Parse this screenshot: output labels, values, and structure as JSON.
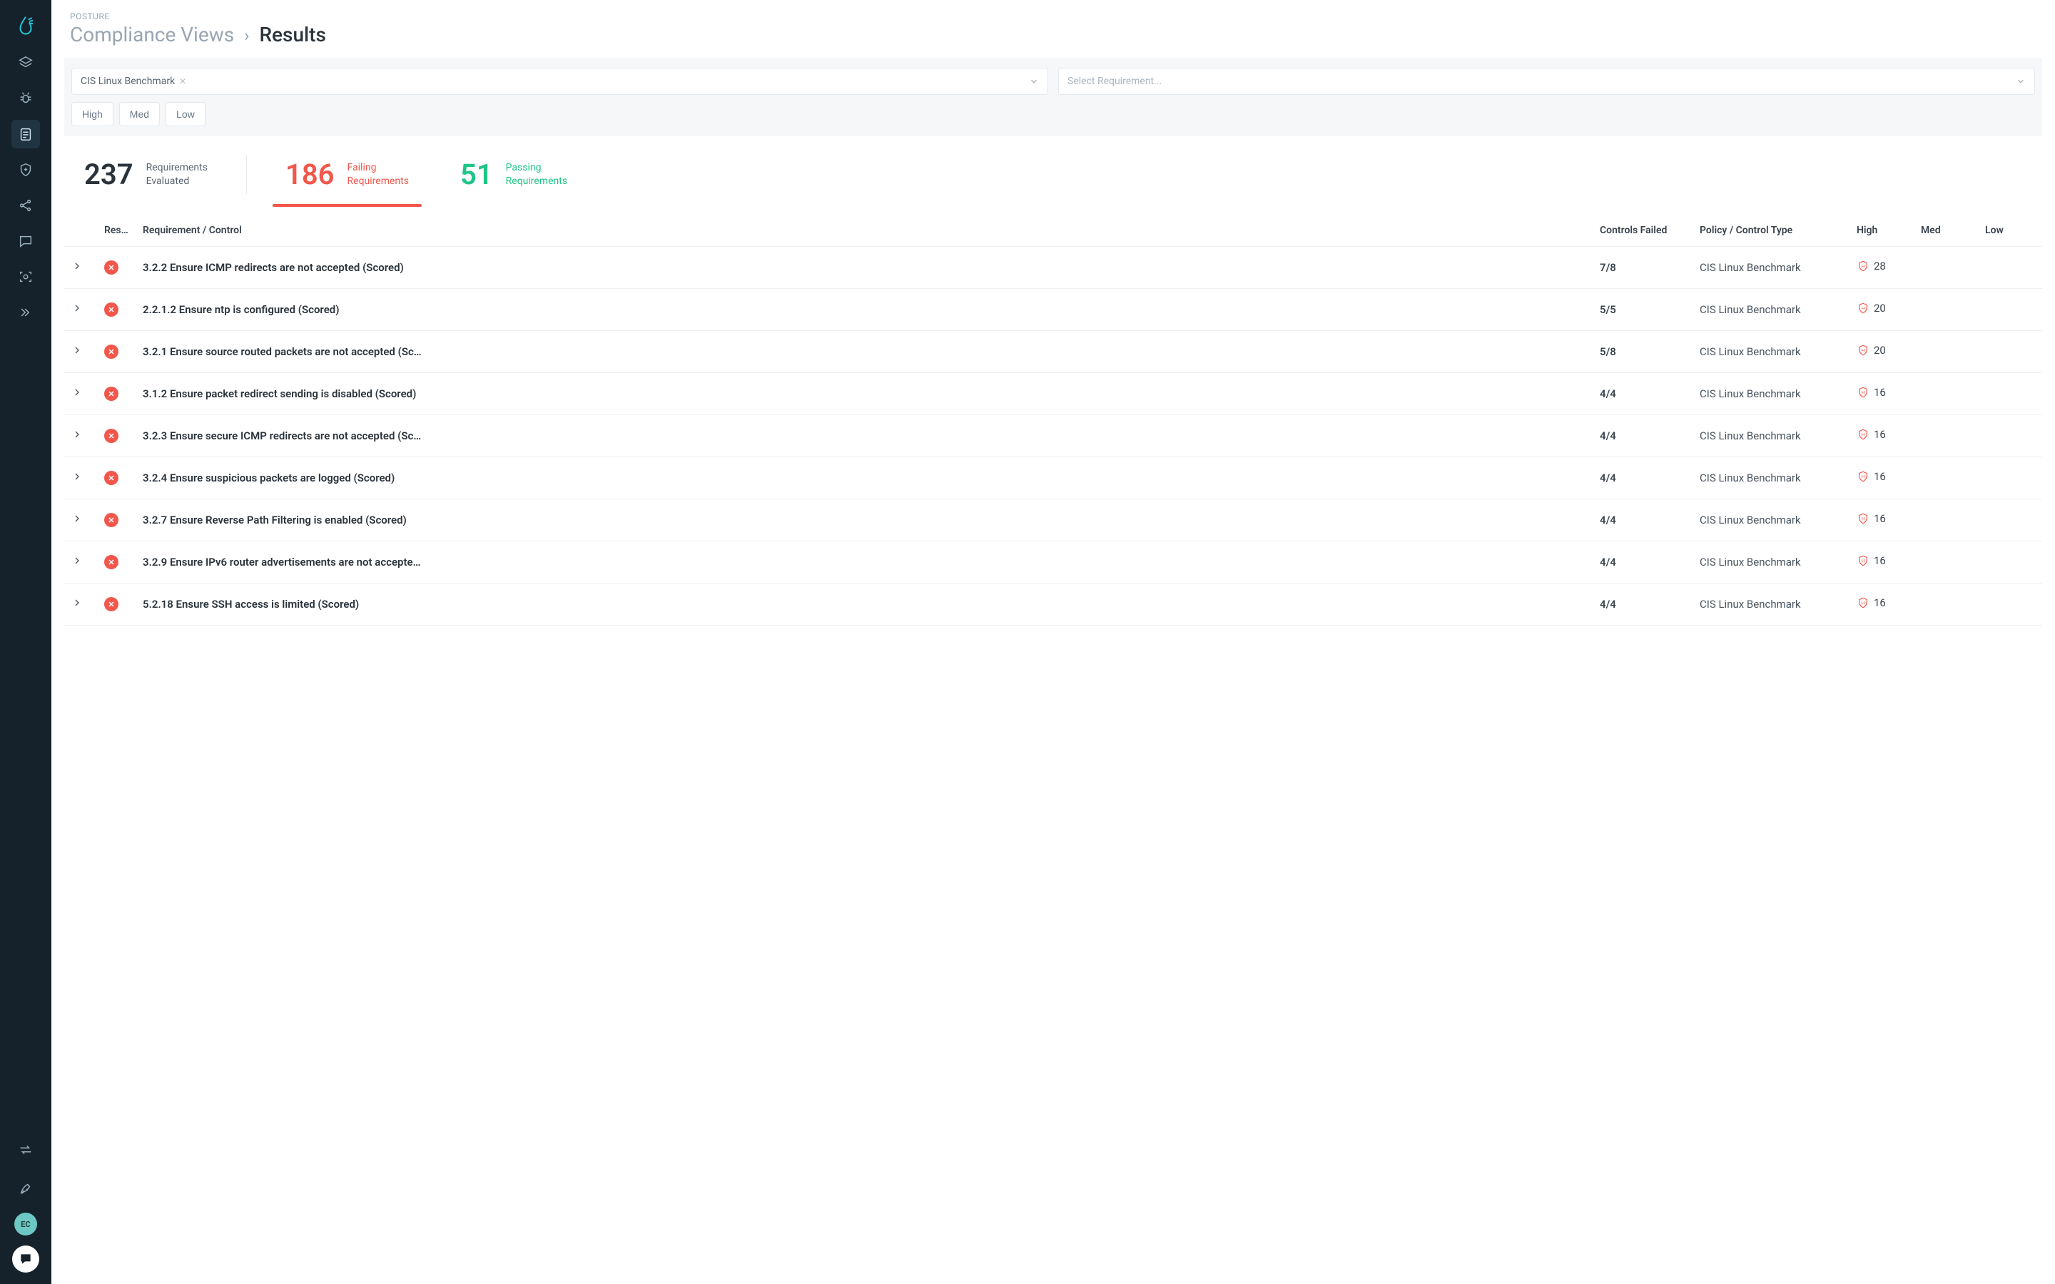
{
  "header": {
    "eyebrow": "POSTURE",
    "breadcrumb_parent": "Compliance Views",
    "breadcrumb_sep": "›",
    "breadcrumb_current": "Results"
  },
  "filters": {
    "benchmark_chip": "CIS Linux Benchmark",
    "requirement_placeholder": "Select Requirement...",
    "severity_labels": {
      "high": "High",
      "med": "Med",
      "low": "Low"
    }
  },
  "stats": {
    "total": {
      "value": "237",
      "label_l1": "Requirements",
      "label_l2": "Evaluated"
    },
    "fail": {
      "value": "186",
      "label_l1": "Failing",
      "label_l2": "Requirements"
    },
    "pass": {
      "value": "51",
      "label_l1": "Passing",
      "label_l2": "Requirements"
    }
  },
  "table": {
    "headers": {
      "result": "Res…",
      "requirement": "Requirement / Control",
      "controls_failed": "Controls Failed",
      "policy": "Policy / Control Type",
      "high": "High",
      "med": "Med",
      "low": "Low"
    },
    "rows": [
      {
        "req": "3.2.2 Ensure ICMP redirects are not accepted (Scored)",
        "cf": "7/8",
        "policy": "CIS Linux Benchmark",
        "high": "28"
      },
      {
        "req": "2.2.1.2 Ensure ntp is configured (Scored)",
        "cf": "5/5",
        "policy": "CIS Linux Benchmark",
        "high": "20"
      },
      {
        "req": "3.2.1 Ensure source routed packets are not accepted (Sc…",
        "cf": "5/8",
        "policy": "CIS Linux Benchmark",
        "high": "20"
      },
      {
        "req": "3.1.2 Ensure packet redirect sending is disabled (Scored)",
        "cf": "4/4",
        "policy": "CIS Linux Benchmark",
        "high": "16"
      },
      {
        "req": "3.2.3 Ensure secure ICMP redirects are not accepted (Sc…",
        "cf": "4/4",
        "policy": "CIS Linux Benchmark",
        "high": "16"
      },
      {
        "req": "3.2.4 Ensure suspicious packets are logged (Scored)",
        "cf": "4/4",
        "policy": "CIS Linux Benchmark",
        "high": "16"
      },
      {
        "req": "3.2.7 Ensure Reverse Path Filtering is enabled (Scored)",
        "cf": "4/4",
        "policy": "CIS Linux Benchmark",
        "high": "16"
      },
      {
        "req": "3.2.9 Ensure IPv6 router advertisements are not accepte…",
        "cf": "4/4",
        "policy": "CIS Linux Benchmark",
        "high": "16"
      },
      {
        "req": "5.2.18 Ensure SSH access is limited (Scored)",
        "cf": "4/4",
        "policy": "CIS Linux Benchmark",
        "high": "16"
      }
    ]
  },
  "sidebar": {
    "avatar_initials": "EC"
  }
}
